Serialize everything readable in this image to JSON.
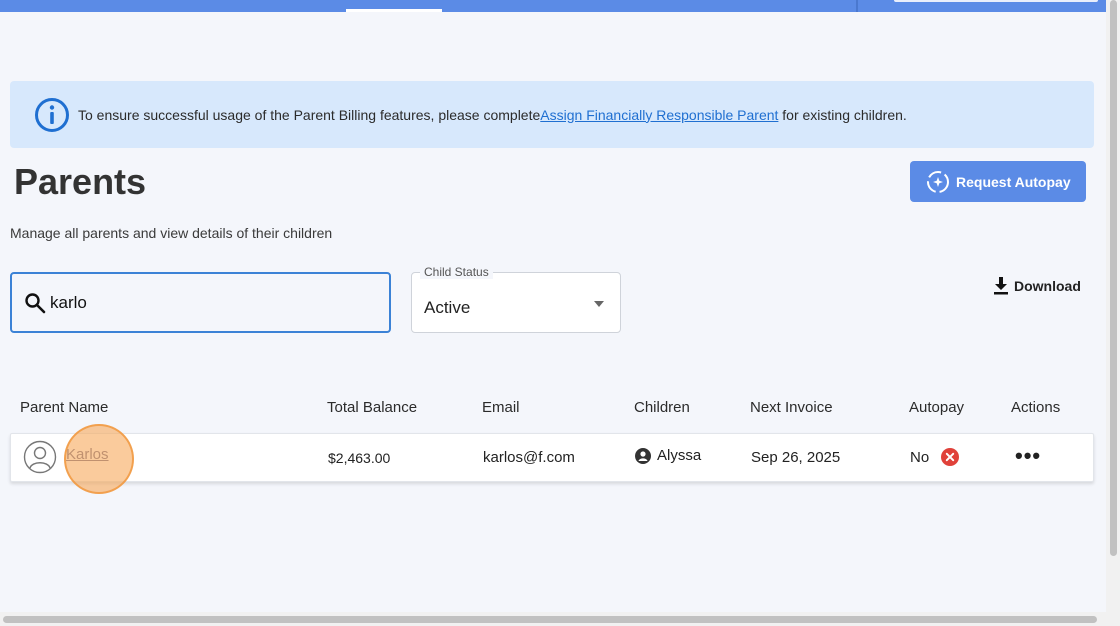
{
  "banner": {
    "text_before": "To ensure successful usage of the Parent Billing features, please complete",
    "link_text": "Assign Financially Responsible Parent",
    "text_after": " for existing children."
  },
  "page": {
    "title": "Parents",
    "subtitle": "Manage all parents and view details of their children"
  },
  "toolbar": {
    "request_autopay_label": "Request Autopay",
    "download_label": "Download"
  },
  "search": {
    "value": "karlo"
  },
  "child_status": {
    "legend": "Child Status",
    "selected": "Active"
  },
  "table": {
    "columns": [
      "Parent Name",
      "Total Balance",
      "Email",
      "Children",
      "Next Invoice",
      "Autopay",
      "Actions"
    ],
    "rows": [
      {
        "parent_name": "Karlos",
        "total_balance": "$2,463.00",
        "email": "karlos@f.com",
        "children": "Alyssa",
        "next_invoice": "Sep 26, 2025",
        "autopay": "No",
        "actions": "•••"
      }
    ]
  },
  "colors": {
    "accent": "#5b8be6",
    "banner_bg": "#d7e8fc",
    "link": "#1f6fd1",
    "autopay_no": "#e0413a"
  },
  "icons": {
    "banner": "info-icon",
    "search": "search-icon",
    "download": "download-icon",
    "autopay_button": "autopay-cycle-icon",
    "avatar": "user-avatar-icon",
    "child": "child-account-icon",
    "autopay_status": "x-circle-icon"
  }
}
